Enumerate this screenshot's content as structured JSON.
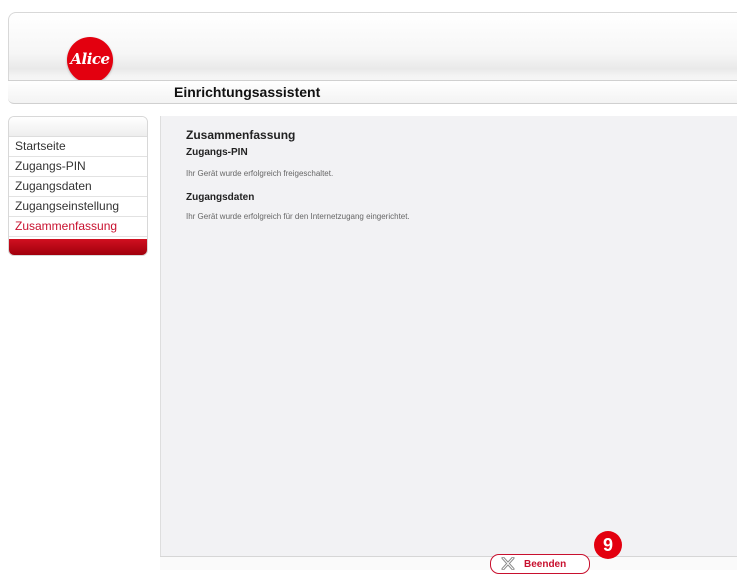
{
  "brand": {
    "logo_text": "Alice"
  },
  "header": {
    "title": "Einrichtungsassistent"
  },
  "sidebar": {
    "items": [
      {
        "label": "Startseite"
      },
      {
        "label": "Zugangs-PIN"
      },
      {
        "label": "Zugangsdaten"
      },
      {
        "label": "Zugangseinstellung"
      },
      {
        "label": "Zusammenfassung",
        "active": true
      }
    ]
  },
  "main": {
    "title": "Zusammenfassung",
    "sections": [
      {
        "heading": "Zugangs-PIN",
        "text": "Ihr Gerät wurde erfolgreich freigeschaltet."
      },
      {
        "heading": "Zugangsdaten",
        "text": "Ihr Gerät wurde erfolgreich für den Internetzugang eingerichtet."
      }
    ]
  },
  "footer": {
    "end_button_label": "Beenden",
    "end_icon": "close-x-icon"
  },
  "annotation": {
    "step_number": "9"
  },
  "colors": {
    "accent": "#e3000f",
    "active_nav": "#c8102e",
    "content_bg": "#f2f2f4"
  }
}
